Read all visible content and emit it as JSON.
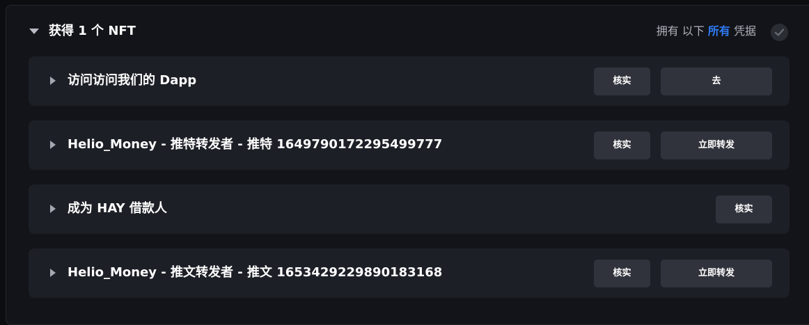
{
  "header": {
    "title": "获得 1 个 NFT",
    "requirement_prefix": "拥有 以下",
    "requirement_accent": "所有",
    "requirement_suffix": "凭据",
    "accent_color": "#2f7bf5"
  },
  "icons": {
    "collapse": "caret-down-icon",
    "expand": "caret-right-icon",
    "status": "check-icon"
  },
  "tasks": [
    {
      "title": "访问访问我们的 Dapp",
      "verify_label": "核实",
      "action_label": "去"
    },
    {
      "title": "Helio_Money - 推特转发者 - 推特 1649790172295499777",
      "verify_label": "核实",
      "action_label": "立即转发"
    },
    {
      "title": "成为 HAY 借款人",
      "verify_label": "核实"
    },
    {
      "title": "Helio_Money - 推文转发者 - 推文 1653429229890183168",
      "verify_label": "核实",
      "action_label": "立即转发"
    }
  ]
}
